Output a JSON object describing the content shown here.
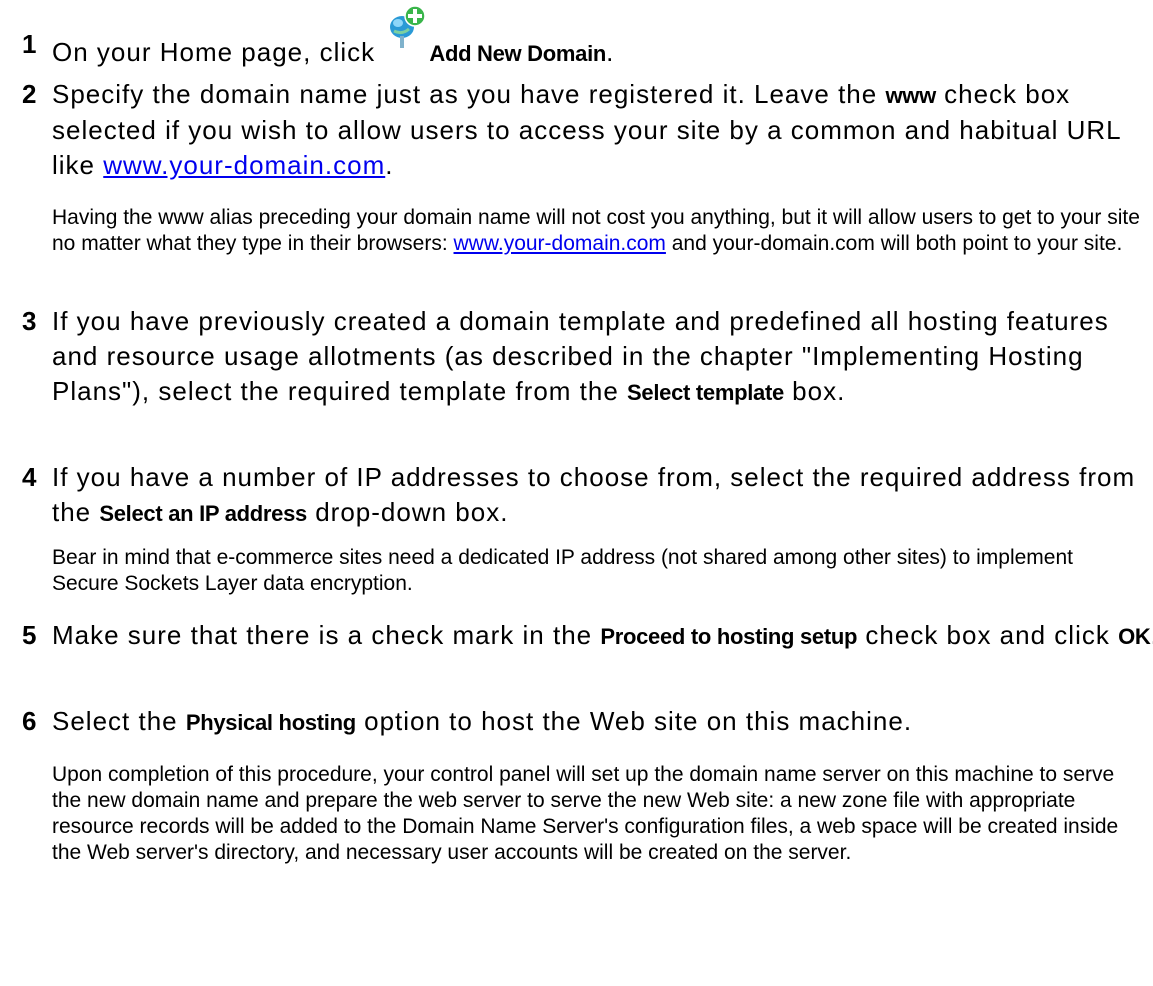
{
  "steps": [
    {
      "num": "1",
      "before": "On your Home page, click ",
      "ui": "Add New Domain",
      "after": ".",
      "icon": "add-domain-icon"
    },
    {
      "num": "2",
      "text1": "Specify the domain name just as you have registered it. Leave the ",
      "ui": "www",
      "text2": " check box selected if you wish to allow users to access your site by a common and habitual URL like ",
      "link": "www.your-domain.com",
      "text3": ".",
      "note": {
        "text1": "Having the www alias preceding your domain name will not cost you anything, but it will allow users to get to your site no matter what they type in their browsers: ",
        "link": "www.your-domain.com",
        "text2": " and your-domain.com will both point to your site."
      }
    },
    {
      "num": "3",
      "text1": "If you have previously created a domain template and predefined all hosting features and resource usage allotments (as described in the chapter \"Implementing Hosting Plans\"), select the required template from the ",
      "ui": "Select template",
      "text2": " box."
    },
    {
      "num": "4",
      "text1": "If you have a number of IP addresses to choose from, select the required address from the ",
      "ui": "Select an IP address",
      "text2": " drop-down box.",
      "note": {
        "text": "Bear in mind that e-commerce sites need a dedicated IP address (not shared among other sites) to implement Secure Sockets Layer data encryption."
      }
    },
    {
      "num": "5",
      "text1": "Make sure that there is a check mark in the ",
      "ui": "Proceed to hosting setup",
      "text2": " check box and click ",
      "ui2": "OK",
      "text3": "."
    },
    {
      "num": "6",
      "text1": "Select the ",
      "ui": "Physical hosting",
      "text2": " option to host the Web site on this machine.",
      "note": {
        "text": "Upon completion of this procedure, your control panel will set up the domain name server on this machine to serve the new domain name and prepare the web server to serve the new Web site: a new zone file with appropriate resource records will be added to the Domain Name Server's configuration files, a web space will be created inside the Web server's directory, and necessary user accounts will be created on the server."
      }
    }
  ],
  "colors": {
    "link": "#0000ee",
    "text": "#000000",
    "icon_globe": "#2a9ad6",
    "icon_plus": "#39b54a"
  }
}
